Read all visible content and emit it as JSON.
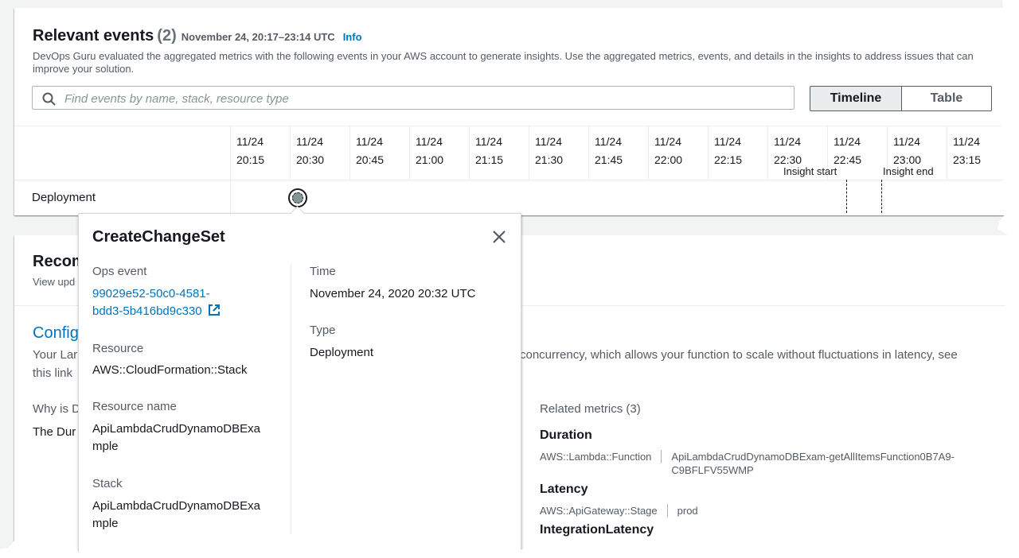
{
  "events": {
    "title": "Relevant events",
    "count": "(2)",
    "range": "November 24, 20:17–23:14 UTC",
    "info": "Info",
    "description": "DevOps Guru evaluated the aggregated metrics with the following events in your AWS account to generate insights. Use the aggregated metrics, events, and details in the insights to address issues that can improve your solution.",
    "search_placeholder": "Find events by name, stack, resource type",
    "view_timeline": "Timeline",
    "view_table": "Table",
    "ticks": [
      {
        "date": "11/24",
        "time": "20:15"
      },
      {
        "date": "11/24",
        "time": "20:30"
      },
      {
        "date": "11/24",
        "time": "20:45"
      },
      {
        "date": "11/24",
        "time": "21:00"
      },
      {
        "date": "11/24",
        "time": "21:15"
      },
      {
        "date": "11/24",
        "time": "21:30"
      },
      {
        "date": "11/24",
        "time": "21:45"
      },
      {
        "date": "11/24",
        "time": "22:00"
      },
      {
        "date": "11/24",
        "time": "22:15"
      },
      {
        "date": "11/24",
        "time": "22:30"
      },
      {
        "date": "11/24",
        "time": "22:45"
      },
      {
        "date": "11/24",
        "time": "23:00"
      },
      {
        "date": "11/24",
        "time": "23:15"
      }
    ],
    "insight_start": "Insight start",
    "insight_end": "Insight end",
    "row_label": "Deployment"
  },
  "popover": {
    "title": "CreateChangeSet",
    "ops_event_label": "Ops event",
    "ops_event_id_line1": "99029e52-50c0-4581-",
    "ops_event_id_line2": "bdd3-5b416bd9c330",
    "resource_label": "Resource",
    "resource_value": "AWS::CloudFormation::Stack",
    "resource_name_label": "Resource name",
    "resource_name_line1": "ApiLambdaCrudDynamoDBExa",
    "resource_name_line2": "mple",
    "stack_label": "Stack",
    "stack_line1": "ApiLambdaCrudDynamoDBExa",
    "stack_line2": "mple",
    "time_label": "Time",
    "time_value": "November 24, 2020 20:32 UTC",
    "type_label": "Type",
    "type_value": "Deployment"
  },
  "recommendations": {
    "title_partial": "Recom",
    "subtitle_partial": "View upd",
    "config_link_partial": "Config",
    "desc1_partial": "Your Lar",
    "desc1_right": "concurrency, which allows your function to scale without fluctuations in latency, see",
    "desc2_partial": "this link",
    "why_partial": "Why is D",
    "the_partial": "The Dur",
    "related_metrics": "Related metrics (3)",
    "metrics": [
      {
        "name": "Duration",
        "resource": "AWS::Lambda::Function",
        "value_line1": "ApiLambdaCrudDynamoDBExam-getAllItemsFunction0B7A9-",
        "value_line2": "C9BFLFV55WMP"
      },
      {
        "name": "Latency",
        "resource": "AWS::ApiGateway::Stage",
        "value_line1": "prod"
      },
      {
        "name": "IntegrationLatency"
      }
    ]
  }
}
